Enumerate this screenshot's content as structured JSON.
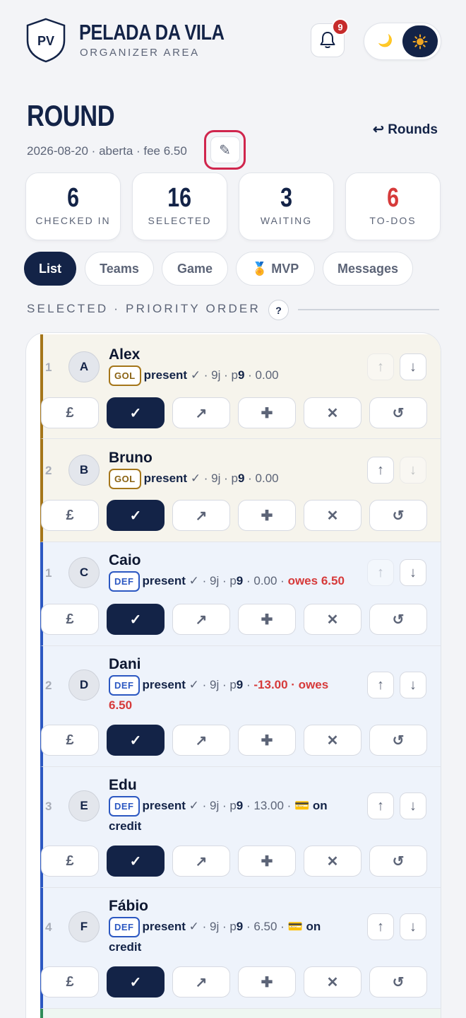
{
  "app": {
    "logo_text": "PV",
    "title": "PELADA DA VILA",
    "subtitle": "ORGANIZER AREA",
    "notification_count": "9"
  },
  "theme": {
    "moon": "🌙",
    "sun": "☀"
  },
  "page": {
    "title": "ROUND",
    "back_link": "↩ Rounds",
    "meta": "2026-08-20 · aberta · fee 6.50",
    "edit_icon": "✎"
  },
  "stats": [
    {
      "value": "6",
      "label": "CHECKED IN"
    },
    {
      "value": "16",
      "label": "SELECTED"
    },
    {
      "value": "3",
      "label": "WAITING"
    },
    {
      "value": "6",
      "label": "TO-DOS"
    }
  ],
  "tabs": [
    "List",
    "Teams",
    "Game",
    "🏅 MVP",
    "Messages"
  ],
  "section": {
    "title": "SELECTED · PRIORITY ORDER",
    "help": "?"
  },
  "actions": [
    "£",
    "✓",
    "↗",
    "✚",
    "✕",
    "↺"
  ],
  "arrows": {
    "up": "↑",
    "down": "↓"
  },
  "players": [
    {
      "num": "1",
      "initial": "A",
      "name": "Alex",
      "pos": "GOL",
      "status": "present",
      "stats": " ✓ · 9j · p",
      "p": "9",
      "balance": " · 0.00",
      "balance_red": "",
      "extra": ""
    },
    {
      "num": "2",
      "initial": "B",
      "name": "Bruno",
      "pos": "GOL",
      "status": "present",
      "stats": " ✓ · 9j · p",
      "p": "9",
      "balance": " · 0.00",
      "balance_red": "",
      "extra": ""
    },
    {
      "num": "1",
      "initial": "C",
      "name": "Caio",
      "pos": "DEF",
      "status": "present",
      "stats": " ✓ · 9j · p",
      "p": "9",
      "balance": " · 0.00 · ",
      "balance_red": "owes 6.50",
      "extra": ""
    },
    {
      "num": "2",
      "initial": "D",
      "name": "Dani",
      "pos": "DEF",
      "status": "present",
      "stats": " ✓ · 9j · p",
      "p": "9",
      "balance": " · ",
      "balance_red": "-13.00 · owes 6.50",
      "extra": ""
    },
    {
      "num": "3",
      "initial": "E",
      "name": "Edu",
      "pos": "DEF",
      "status": "present",
      "stats": " ✓ · 9j · p",
      "p": "9",
      "balance": " · 13.00 · 💳 ",
      "balance_red": "",
      "extra": "on credit"
    },
    {
      "num": "4",
      "initial": "F",
      "name": "Fábio",
      "pos": "DEF",
      "status": "present",
      "stats": " ✓ · 9j · p",
      "p": "9",
      "balance": " · 6.50 · 💳 ",
      "balance_red": "",
      "extra": "on credit"
    }
  ]
}
